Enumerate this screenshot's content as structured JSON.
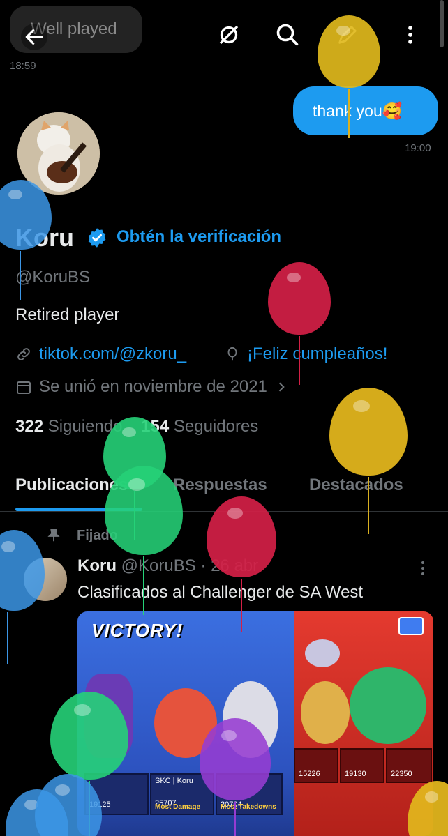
{
  "chat": {
    "incoming_text": "Well played",
    "incoming_time": "18:59",
    "outgoing_text": "thank you🥰",
    "outgoing_time": "19:00"
  },
  "toolbar": {
    "back_icon": "arrow-left-icon",
    "icons": [
      "link-off-icon",
      "search-icon",
      "compose-icon",
      "more-vertical-icon"
    ]
  },
  "profile": {
    "name": "Koru",
    "verify_link": "Obtén la verificación",
    "handle": "@KoruBS",
    "bio": "Retired player",
    "website": "tiktok.com/@zkoru_",
    "birthday": "¡Feliz cumpleaños!",
    "joined": "Se unió en noviembre de 2021",
    "following_count": "322",
    "following_label": "Siguiendo",
    "followers_count": "154",
    "followers_label": "Seguidores"
  },
  "tabs": [
    {
      "label": "Publicaciones",
      "active": true
    },
    {
      "label": "Respuestas",
      "active": false
    },
    {
      "label": "Destacados",
      "active": false
    }
  ],
  "post": {
    "pinned_label": "Fijado",
    "author": "Koru",
    "meta": "@KoruBS · 26 abr",
    "text": "Clasificados al Challenger de SA West",
    "media": {
      "title": "VICTORY!",
      "left_scores": [
        "19125",
        "25707",
        "20704"
      ],
      "left_labels": [
        "Most Damage",
        "Most Takedowns"
      ],
      "left_names": [
        "SKC | Koru"
      ],
      "right_scores": [
        "15226",
        "19130",
        "22350"
      ]
    }
  },
  "colors": {
    "accent": "#1d9bf0",
    "background": "#000000",
    "muted": "#71767b"
  }
}
